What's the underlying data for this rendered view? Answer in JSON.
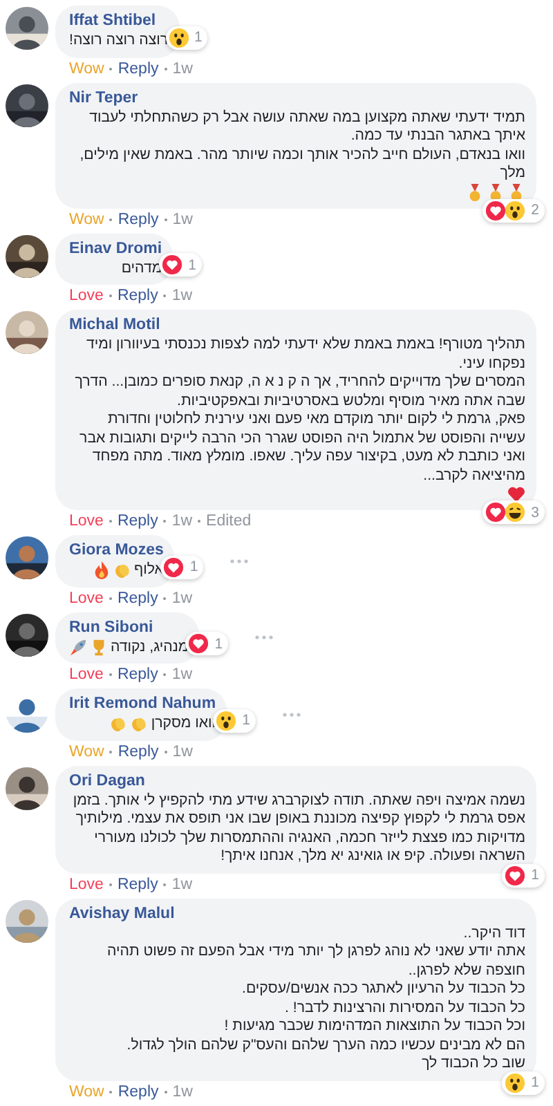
{
  "comments": [
    {
      "author": "Iffat Shtibel",
      "paragraphs": [
        {
          "text": "רוצה רוצה רוצה!"
        }
      ],
      "reactions": {
        "icons": [
          {
            "kind": "wow"
          }
        ],
        "count": "1"
      },
      "actions": {
        "reaction": {
          "label": "Wow",
          "kind": "wow"
        },
        "reply": "Reply",
        "time": "1w"
      },
      "more": false,
      "avatar": {
        "kind": "picture"
      }
    },
    {
      "author": "Nir Teper",
      "paragraphs": [
        {
          "text": "תמיד ידעתי שאתה מקצוען במה שאתה עושה אבל רק כשהתחלתי לעבוד איתך באתגר הבנתי עד כמה."
        },
        {
          "text": "וואו בנאדם, העולם חייב להכיר אותך וכמה שיותר מהר. באמת שאין מילים, מלך",
          "emojis": [
            {
              "kind": "medal"
            },
            {
              "kind": "medal"
            },
            {
              "kind": "medal"
            }
          ]
        }
      ],
      "reactions": {
        "icons": [
          {
            "kind": "love"
          },
          {
            "kind": "wow"
          }
        ],
        "count": "2"
      },
      "actions": {
        "reaction": {
          "label": "Wow",
          "kind": "wow"
        },
        "reply": "Reply",
        "time": "1w"
      },
      "more": false,
      "avatar": {
        "kind": "picture"
      }
    },
    {
      "author": "Einav Dromi",
      "paragraphs": [
        {
          "text": "מדהים"
        }
      ],
      "reactions": {
        "icons": [
          {
            "kind": "love"
          }
        ],
        "count": "1"
      },
      "actions": {
        "reaction": {
          "label": "Love",
          "kind": "love"
        },
        "reply": "Reply",
        "time": "1w"
      },
      "more": false,
      "avatar": {
        "kind": "picture"
      }
    },
    {
      "author": "Michal Motil",
      "paragraphs": [
        {
          "text": "תהליך מטורף! באמת באמת שלא ידעתי למה לצפות נכנסתי בעיוורון ומיד נפקחו עיני."
        },
        {
          "text": "המסרים שלך מדוייקים להחריד, אך ה ק נ א ה, קנאת סופרים כמובן... הדרך שבה אתה מאיר מוסיף ומלטש באסרטיביות ובאפקטיביות."
        },
        {
          "text": "פאק, גרמת לי לקום יותר מוקדם מאי פעם ואני עירנית לחלוטין וחדורת עשייה והפוסט של אתמול היה הפוסט שגרר הכי הרבה לייקים ותגובות אבר ואני כותבת לא מעט, בקיצור עפה עליך. שאפו. מומלץ מאוד. מתה מפחד מהיציאה לקרב...",
          "emojis": [
            {
              "kind": "heart"
            }
          ]
        }
      ],
      "reactions": {
        "icons": [
          {
            "kind": "love"
          },
          {
            "kind": "haha"
          }
        ],
        "count": "3"
      },
      "actions": {
        "reaction": {
          "label": "Love",
          "kind": "love"
        },
        "reply": "Reply",
        "time": "1w",
        "edited": "Edited"
      },
      "more": false,
      "avatar": {
        "kind": "picture"
      }
    },
    {
      "author": "Giora Mozes",
      "paragraphs": [
        {
          "text": "אלוף",
          "emojis": [
            {
              "kind": "clap"
            },
            {
              "kind": "fire"
            }
          ]
        }
      ],
      "reactions": {
        "icons": [
          {
            "kind": "love"
          }
        ],
        "count": "1"
      },
      "actions": {
        "reaction": {
          "label": "Love",
          "kind": "love"
        },
        "reply": "Reply",
        "time": "1w"
      },
      "more": true,
      "avatar": {
        "kind": "picture"
      }
    },
    {
      "author": "Run Siboni",
      "paragraphs": [
        {
          "text": "מנהיג, נקודה",
          "emojis": [
            {
              "kind": "trophy"
            },
            {
              "kind": "rocket"
            }
          ]
        }
      ],
      "reactions": {
        "icons": [
          {
            "kind": "love"
          }
        ],
        "count": "1"
      },
      "actions": {
        "reaction": {
          "label": "Love",
          "kind": "love"
        },
        "reply": "Reply",
        "time": "1w"
      },
      "more": true,
      "avatar": {
        "kind": "picture"
      }
    },
    {
      "author": "Irit Remond Nahum",
      "paragraphs": [
        {
          "text": "וואו מסקרן",
          "emojis": [
            {
              "kind": "clap"
            },
            {
              "kind": "clap"
            }
          ]
        }
      ],
      "reactions": {
        "icons": [
          {
            "kind": "wow"
          }
        ],
        "count": "1"
      },
      "actions": {
        "reaction": {
          "label": "Wow",
          "kind": "wow"
        },
        "reply": "Reply",
        "time": "1w"
      },
      "more": true,
      "avatar": {
        "kind": "picture"
      }
    },
    {
      "author": "Ori Dagan",
      "paragraphs": [
        {
          "text": "נשמה אמיצה ויפה שאתה. תודה לצוקרברג שידע מתי להקפיץ לי אותך. בזמן אפס גרמת לי לקפוץ קפיצה מכוננת באופן שבו אני תופס את עצמי. מילותיך מדויקות כמו פצצת לייזר חכמה, האנגיה וההתמסרות שלך לכולנו מעוררי השראה ופעולה. קיפ או גואינג יא מלך, אנחנו איתך!"
        }
      ],
      "reactions": {
        "icons": [
          {
            "kind": "love"
          }
        ],
        "count": "1"
      },
      "actions": {
        "reaction": {
          "label": "Love",
          "kind": "love"
        },
        "reply": "Reply",
        "time": "1w"
      },
      "more": false,
      "avatar": {
        "kind": "picture"
      }
    },
    {
      "author": "Avishay Malul",
      "paragraphs": [
        {
          "text": "דוד היקר.."
        },
        {
          "text": "אתה יודע שאני לא נוהג לפרגן לך יותר מידי אבל הפעם זה פשוט תהיה חוצפה שלא לפרגן.."
        },
        {
          "text": "כל הכבוד על הרעיון לאתגר ככה אנשים/עסקים."
        },
        {
          "text": "כל הכבוד על המסירות והרצינות לדבר! ."
        },
        {
          "text": "וכל הכבוד על התוצאות המדהימות שכבר מגיעות !"
        },
        {
          "text": "הם לא מבינים עכשיו כמה הערך שלהם והעס\"ק שלהם הולך לגדול."
        },
        {
          "text": "שוב כל הכבוד לך"
        }
      ],
      "reactions": {
        "icons": [
          {
            "kind": "wow"
          }
        ],
        "count": "1"
      },
      "actions": {
        "reaction": {
          "label": "Wow",
          "kind": "wow"
        },
        "reply": "Reply",
        "time": "1w"
      },
      "more": false,
      "avatar": {
        "kind": "picture"
      }
    }
  ]
}
